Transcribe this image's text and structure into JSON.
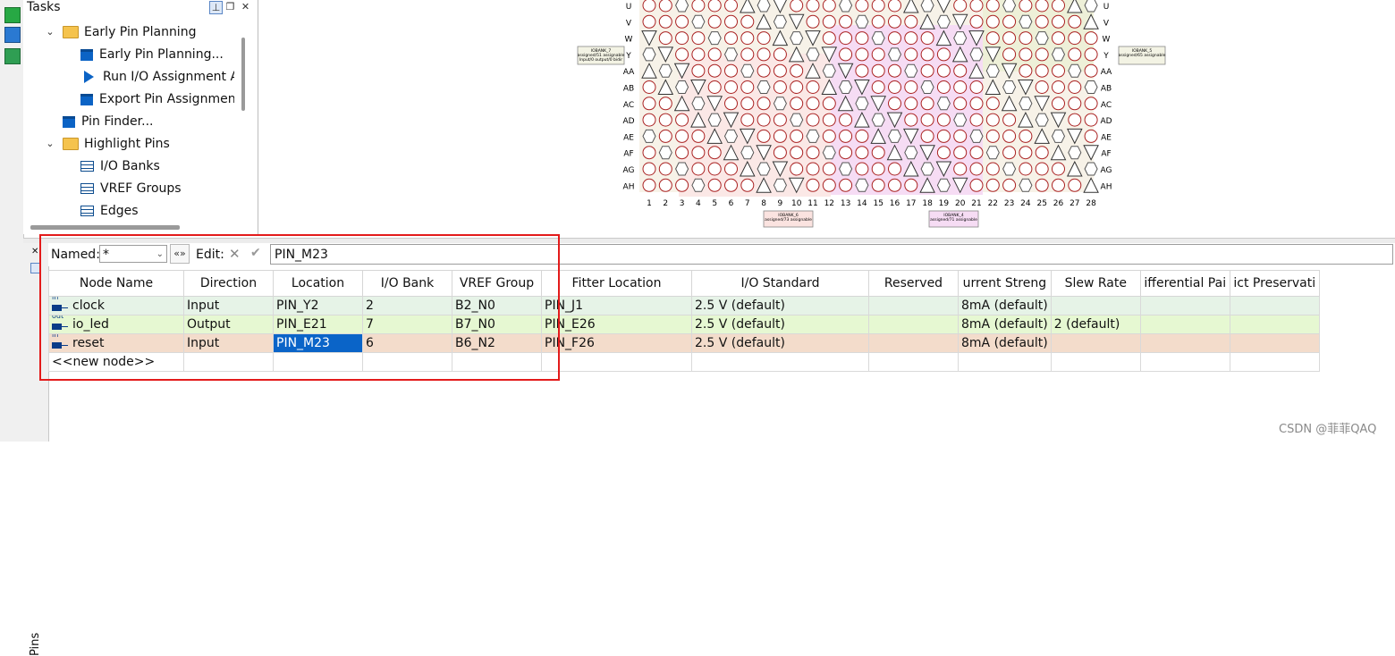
{
  "tasks_panel": {
    "title": "Tasks",
    "tree": [
      {
        "label": "Early Pin Planning",
        "icon": "folder-icon",
        "level": 1,
        "expanded": true
      },
      {
        "label": "Early Pin Planning...",
        "icon": "doc-icon",
        "level": 2
      },
      {
        "label": "Run I/O Assignment A",
        "icon": "run-icon",
        "level": 2
      },
      {
        "label": "Export Pin Assignmen",
        "icon": "doc-icon",
        "level": 2
      },
      {
        "label": "Pin Finder...",
        "icon": "doc-icon",
        "level": 1
      },
      {
        "label": "Highlight Pins",
        "icon": "folder-icon",
        "level": 1,
        "expanded": true
      },
      {
        "label": "I/O Banks",
        "icon": "table-icon",
        "level": 2
      },
      {
        "label": "VREF Groups",
        "icon": "table-icon",
        "level": 2
      },
      {
        "label": "Edges",
        "icon": "table-icon",
        "level": 2
      }
    ]
  },
  "pin_planner": {
    "row_labels": [
      "U",
      "V",
      "W",
      "Y",
      "AA",
      "AB",
      "AC",
      "AD",
      "AE",
      "AF",
      "AG",
      "AH"
    ],
    "col_labels": [
      "1",
      "2",
      "3",
      "4",
      "5",
      "6",
      "7",
      "8",
      "9",
      "10",
      "11",
      "12",
      "13",
      "14",
      "15",
      "16",
      "17",
      "18",
      "19",
      "20",
      "21",
      "22",
      "23",
      "24",
      "25",
      "26",
      "27",
      "28"
    ],
    "bank_boxes": [
      {
        "text": "IOBANK_7\nassigned/51 assignable\nInput/0 output/0 bidir"
      },
      {
        "text": "IOBANK_5\nassigned/65 assignable"
      },
      {
        "text": "IOBANK_6\nassigned/73 assignable"
      },
      {
        "text": "IOBANK_4\nassigned/71 assignable"
      }
    ]
  },
  "side_panel": {
    "label": "Pins"
  },
  "filter_bar": {
    "named_label": "Named:",
    "named_value": "*",
    "edit_label": "Edit:",
    "edit_value": "PIN_M23"
  },
  "table": {
    "columns": [
      "Node Name",
      "Direction",
      "Location",
      "I/O Bank",
      "VREF Group",
      "Fitter Location",
      "I/O Standard",
      "Reserved",
      "urrent Streng",
      "Slew Rate",
      "ifferential Pai",
      "ict Preservati"
    ],
    "rows": [
      {
        "icon_tag": "in",
        "name": "clock",
        "direction": "Input",
        "location": "PIN_Y2",
        "bank": "2",
        "vref": "B2_N0",
        "fitter": "PIN_J1",
        "standard": "2.5 V (default)",
        "reserved": "",
        "current": "8mA (default)",
        "slew": "",
        "diff": "",
        "strict": ""
      },
      {
        "icon_tag": "out",
        "name": "io_led",
        "direction": "Output",
        "location": "PIN_E21",
        "bank": "7",
        "vref": "B7_N0",
        "fitter": "PIN_E26",
        "standard": "2.5 V (default)",
        "reserved": "",
        "current": "8mA (default)",
        "slew": "2 (default)",
        "diff": "",
        "strict": ""
      },
      {
        "icon_tag": "in",
        "name": "reset",
        "direction": "Input",
        "location": "PIN_M23",
        "bank": "6",
        "vref": "B6_N2",
        "fitter": "PIN_F26",
        "standard": "2.5 V (default)",
        "reserved": "",
        "current": "8mA (default)",
        "slew": "",
        "diff": "",
        "strict": ""
      }
    ],
    "new_node": "<<new node>>"
  },
  "watermark": "CSDN @菲菲QAQ",
  "colors": {
    "selection": "#0a64c8",
    "highlight_box": "#e31b1b"
  }
}
